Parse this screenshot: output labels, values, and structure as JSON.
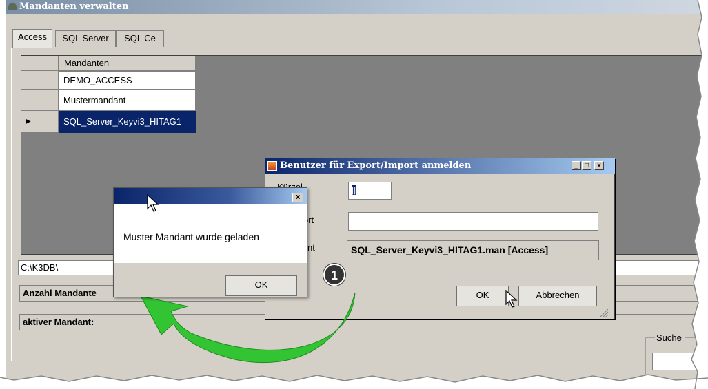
{
  "main_window": {
    "title": "Mandanten verwalten"
  },
  "tabs": [
    "Access",
    "SQL Server",
    "SQL Ce"
  ],
  "grid": {
    "header": "Mandanten",
    "rows": [
      "DEMO_ACCESS",
      "Mustermandant",
      "SQL_Server_Keyvi3_HITAG1"
    ],
    "selected_row_indicator": "▶"
  },
  "path_field": "C:\\K3DB\\",
  "labels": {
    "anzahl": "Anzahl Mandante",
    "aktiv": "aktiver Mandant:"
  },
  "suche": {
    "label": "Suche"
  },
  "login_dialog": {
    "title": "Benutzer für Export/Import anmelden",
    "label_user": "Kürzel",
    "label_password": "ort",
    "label_mandant": "nt",
    "user_value": "||",
    "mandant_value": "SQL_Server_Keyvi3_HITAG1.man [Access]",
    "ok": "OK",
    "cancel": "Abbrechen"
  },
  "message_box": {
    "text": "Muster Mandant wurde geladen",
    "ok": "OK",
    "close": "x"
  },
  "annotation": {
    "step": "1"
  },
  "colors": {
    "title_blue": "#0a246a",
    "selection_blue": "#0a246a",
    "arrow_green": "#2fbf2f"
  }
}
